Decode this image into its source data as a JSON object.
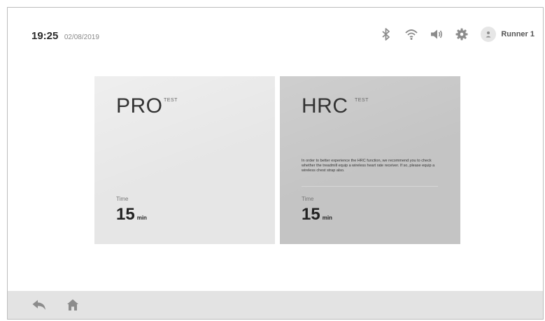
{
  "header": {
    "time": "19:25",
    "date": "02/08/2019",
    "user_name": "Runner 1",
    "icons": [
      "bluetooth-icon",
      "wifi-icon",
      "volume-icon",
      "gear-icon",
      "user-icon"
    ]
  },
  "cards": [
    {
      "title": "PRO",
      "tag": "TEST",
      "time_label": "Time",
      "time_value": "15",
      "time_unit": "min"
    },
    {
      "title": "HRC",
      "tag": "TEST",
      "description": "In order to better experience the HRC function, we recommend you to check whether the treadmill equip a wireless heart rate receiver. If so, please equip a wireless chest strap also.",
      "time_label": "Time",
      "time_value": "15",
      "time_unit": "min"
    }
  ],
  "footer": {
    "icons": [
      "back-icon",
      "home-icon"
    ]
  },
  "colors": {
    "pro_card": "#e6e6e6",
    "hrc_card": "#c4c4c4",
    "footer_bar": "#e3e3e3",
    "icon": "#8c8c8c"
  }
}
